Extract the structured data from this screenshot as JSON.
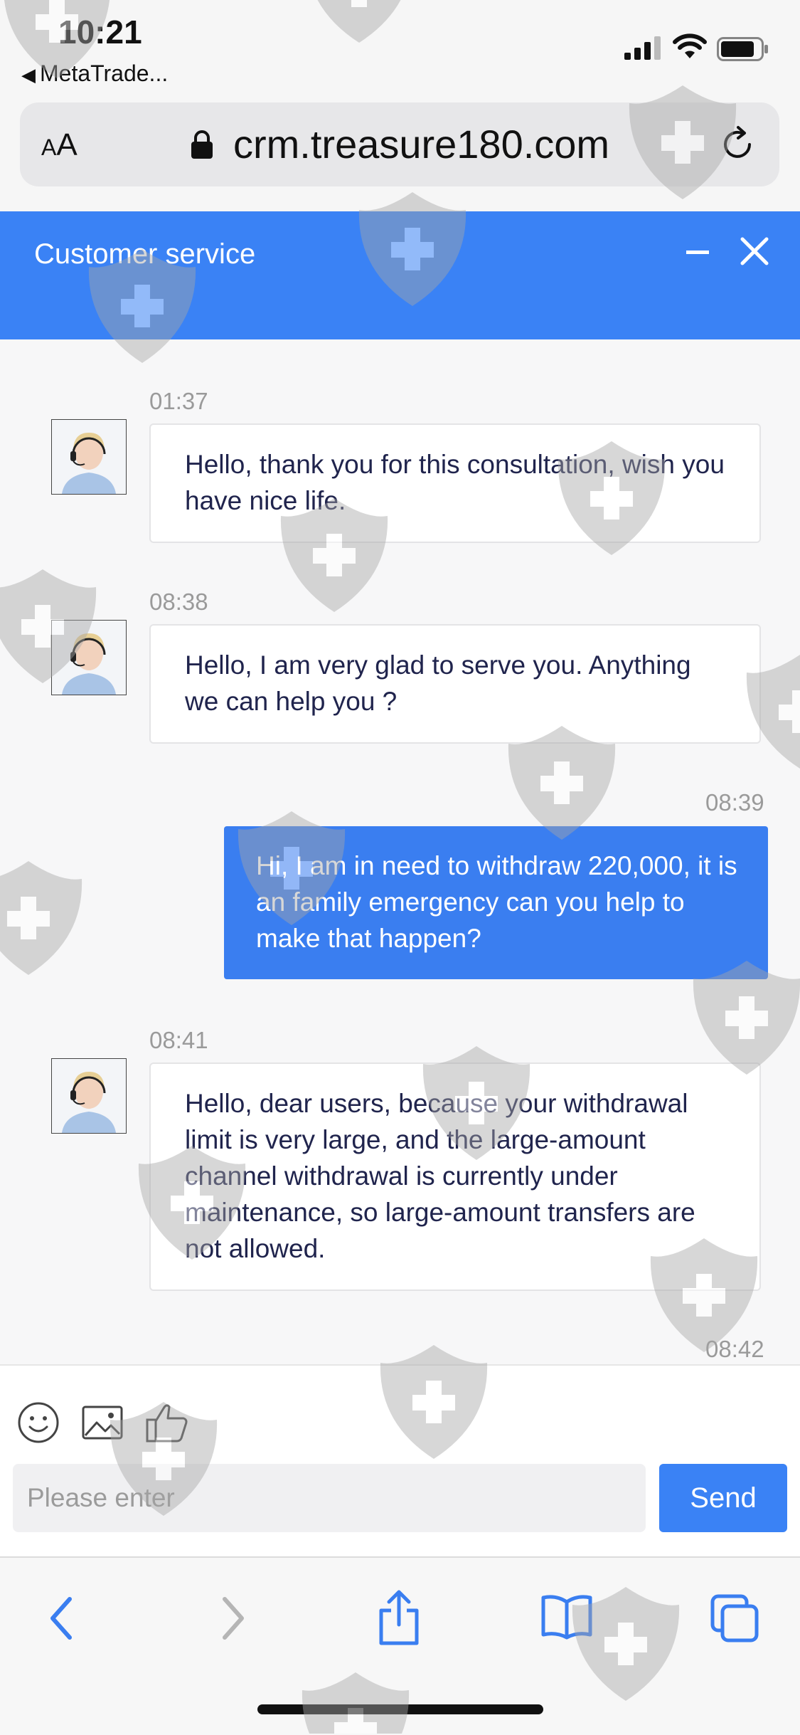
{
  "status_bar": {
    "time": "10:21",
    "back_app": "MetaTrade..."
  },
  "browser": {
    "text_size_label": "AA",
    "url": "crm.treasure180.com"
  },
  "chat": {
    "title": "Customer service",
    "messages": [
      {
        "time": "01:37",
        "direction": "incoming",
        "text": "Hello, thank you for this consultation, wish you have nice life."
      },
      {
        "time": "08:38",
        "direction": "incoming",
        "text": "Hello, I am very glad to serve you. Anything we can help you ?"
      },
      {
        "time": "08:39",
        "direction": "outgoing",
        "text": "Hi, I am in need to withdraw 220,000, it is an family emergency can you help to make that happen?"
      },
      {
        "time": "08:41",
        "direction": "incoming",
        "text": "Hello, dear users, because your withdrawal limit is very large, and the large-amount channel withdrawal is currently under maintenance, so large-amount transfers are not allowed."
      },
      {
        "time": "08:42"
      }
    ]
  },
  "composer": {
    "placeholder": "Please enter",
    "send_label": "Send",
    "tools": [
      "emoji-icon",
      "image-icon",
      "thumbs-up-icon"
    ]
  },
  "colors": {
    "accent": "#3a82f5",
    "outgoing_bubble": "#3a7ef0",
    "incoming_text": "#20244d",
    "timestamp": "#9a9a9a"
  }
}
